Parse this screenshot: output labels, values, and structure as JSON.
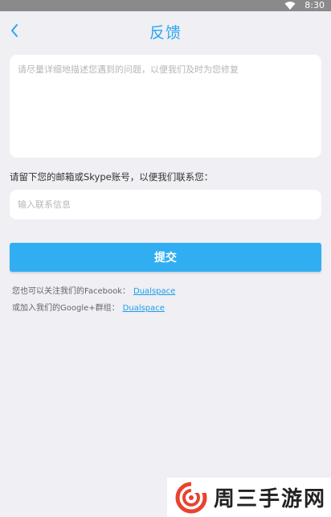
{
  "status_bar": {
    "time": "8:30",
    "wifi_icon": "wifi-icon"
  },
  "header": {
    "title": "反馈",
    "back_icon": "chevron-left-icon"
  },
  "feedback": {
    "placeholder": "请尽量详细地描述您遇到的问题，以便我们及时为您修复"
  },
  "contact": {
    "label": "请留下您的邮箱或Skype账号，以便我们联系您：",
    "placeholder": "输入联系信息"
  },
  "submit_label": "提交",
  "follow": {
    "facebook_text": "您也可以关注我们的Facebook：",
    "facebook_link": "Dualspace",
    "google_text": "或加入我们的Google+群组：",
    "google_link": "Dualspace"
  },
  "watermark": {
    "text": "周三手游网"
  },
  "colors": {
    "accent": "#2aa7ee",
    "button": "#31aef2",
    "link": "#1e9be6",
    "background": "#efeff4"
  }
}
